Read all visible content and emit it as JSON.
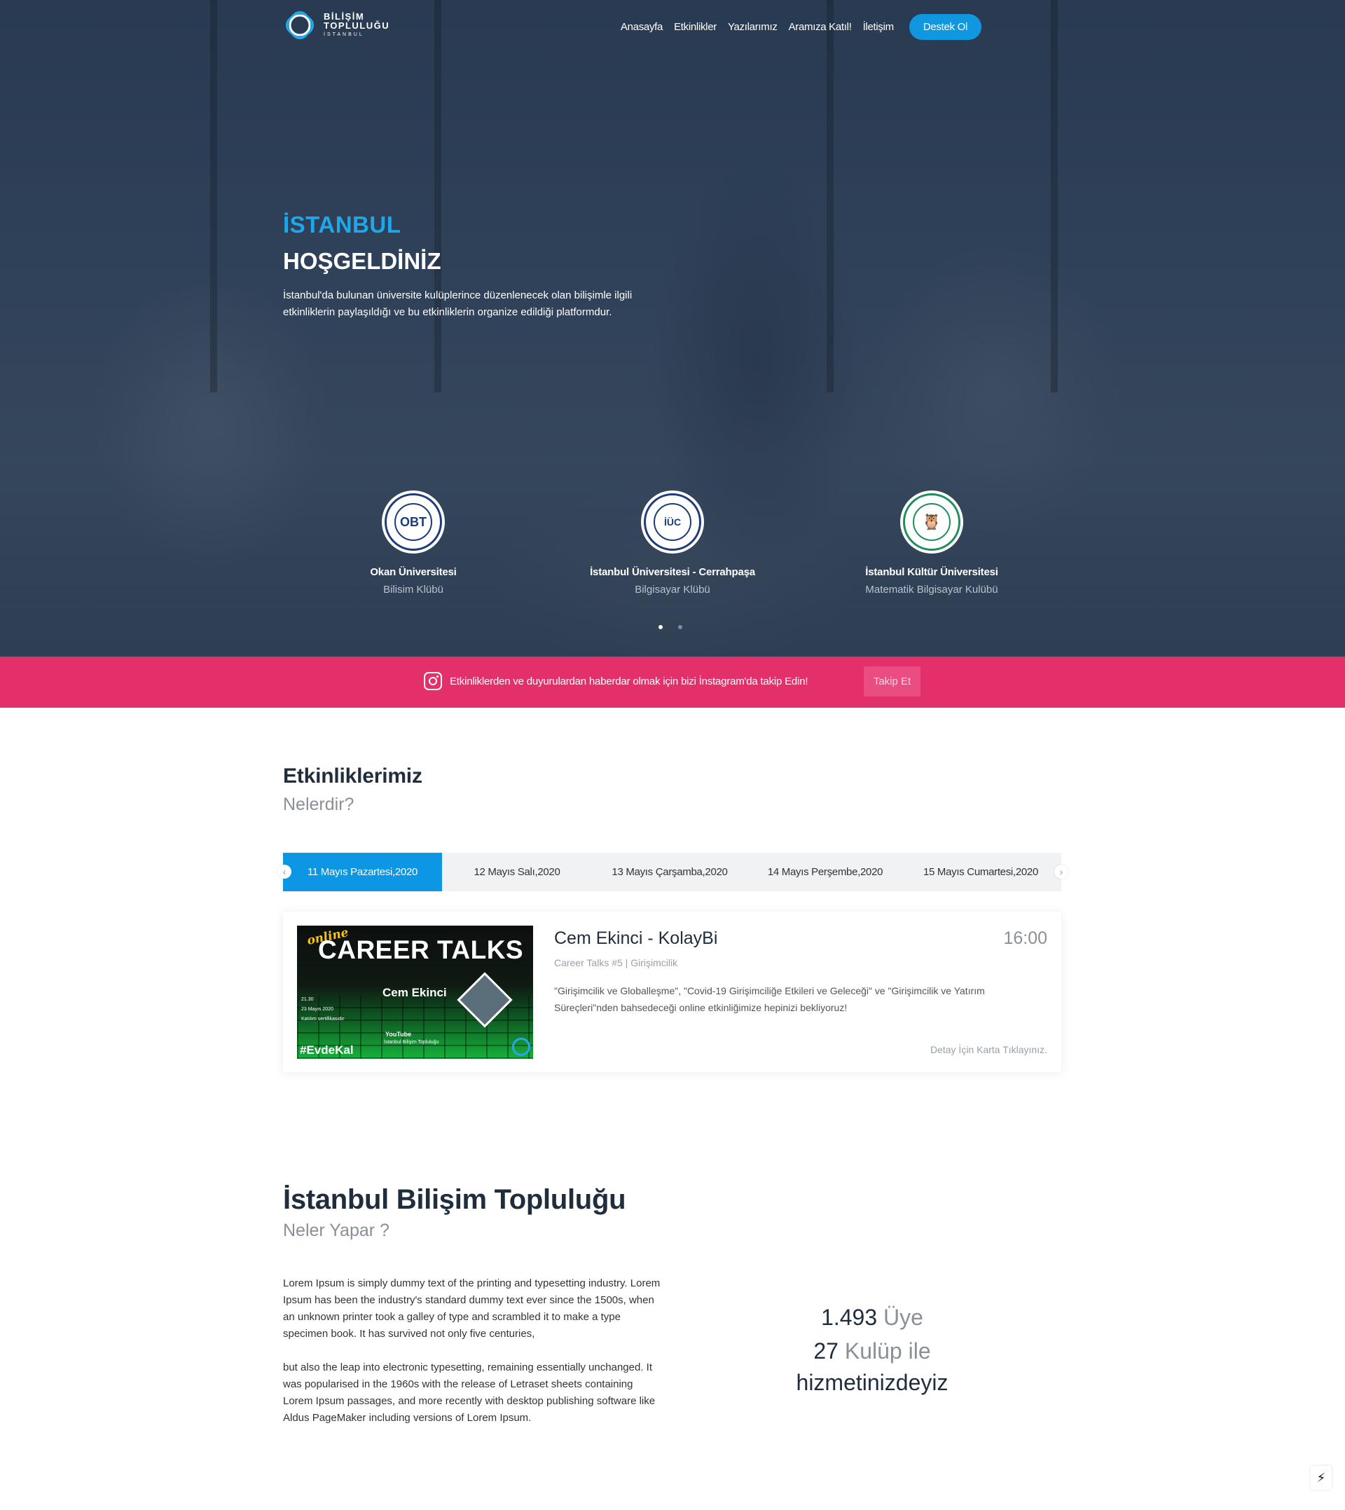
{
  "nav": {
    "logo": {
      "line1": "BİLİŞİM",
      "line2": "TOPLULUĞU",
      "line3": "İSTANBUL"
    },
    "links": [
      "Anasayfa",
      "Etkinlikler",
      "Yazılarımız",
      "Aramıza Katıl!",
      "İletişim"
    ],
    "cta": "Destek Ol"
  },
  "hero": {
    "city": "İSTANBUL",
    "welcome": "HOŞGELDİNİZ",
    "description": "İstanbul'da bulunan üniversite kulüplerince düzenlenecek olan bilişimle ilgili etkinliklerin paylaşıldığı ve bu etkinliklerin organize edildiği platformdur."
  },
  "clubs": [
    {
      "university": "Okan Üniversitesi",
      "club": "Bilisim Klübü",
      "logo_text": "OBT"
    },
    {
      "university": "İstanbul Üniversitesi - Cerrahpaşa",
      "club": "Bilgisayar Klübü",
      "logo_text": "İÜC"
    },
    {
      "university": "İstanbul Kültür Üniversitesi",
      "club": "Matematik Bilgisayar Kulübü",
      "logo_text": "🦉"
    }
  ],
  "carousel": {
    "active_index": 0,
    "count": 2
  },
  "instagram": {
    "text": "Etkinliklerden ve duyurulardan haberdar olmak için bizi İnstagram'da takip Edin!",
    "button": "Takip Et"
  },
  "events_section": {
    "title": "Etkinliklerimiz",
    "subtitle": "Nelerdir?",
    "tabs": [
      "11 Mayıs Pazartesi,2020",
      "12 Mayıs Salı,2020",
      "13 Mayıs Çarşamba,2020",
      "14 Mayıs Perşembe,2020",
      "15 Mayıs Cumartesi,2020"
    ],
    "active_tab": 0
  },
  "event": {
    "image": {
      "online": "online",
      "heading": "CAREER TALKS",
      "person": "Cem Ekinci",
      "time": "21.30",
      "date": "23 Mayıs 2020",
      "cert": "Katılım sertifikasıdır",
      "hashtag": "#EvdeKal",
      "platform": "YouTube",
      "channel": "İstanbul Bilişim Topluluğu"
    },
    "title": "Cem Ekinci - KolayBi",
    "time": "16:00",
    "tags": "Career Talks #5 | Girişimcilik",
    "description": "\"Girişimcilik ve Globalleşme\", \"Covid-19 Girişimciliğe Etkileri ve Geleceği\" ve \"Girişimcilik ve Yatırım Süreçleri\"nden bahsedeceği online etkinliğimize hepinizi bekliyoruz!",
    "hint": "Detay İçin Karta Tıklayınız."
  },
  "about": {
    "title": "İstanbul Bilişim Topluluğu",
    "subtitle": "Neler Yapar ?",
    "paragraphs": [
      "Lorem Ipsum is simply dummy text of the printing and typesetting industry. Lorem Ipsum has been the industry's standard dummy text ever since the 1500s, when an unknown printer took a galley of type and scrambled it to make a type specimen book. It has survived not only five centuries,",
      "but also the leap into electronic typesetting, remaining essentially unchanged. It was popularised in the 1960s with the release of Letraset sheets containing Lorem Ipsum passages, and more recently with desktop publishing software like Aldus PageMaker including versions of Lorem Ipsum."
    ]
  },
  "stats": {
    "members_value": "1.493",
    "members_label": "Üye",
    "clubs_value": "27",
    "clubs_label": "Kulüp ile",
    "closing": "hizmetinizdeyiz"
  },
  "colors": {
    "accent": "#1097e0",
    "instagram": "#e3306b",
    "heading": "#1f2d3d",
    "muted": "#8a9097"
  },
  "icons": [
    "logo-icon",
    "instagram-icon",
    "chevron-left-icon",
    "chevron-right-icon",
    "flash-icon"
  ]
}
